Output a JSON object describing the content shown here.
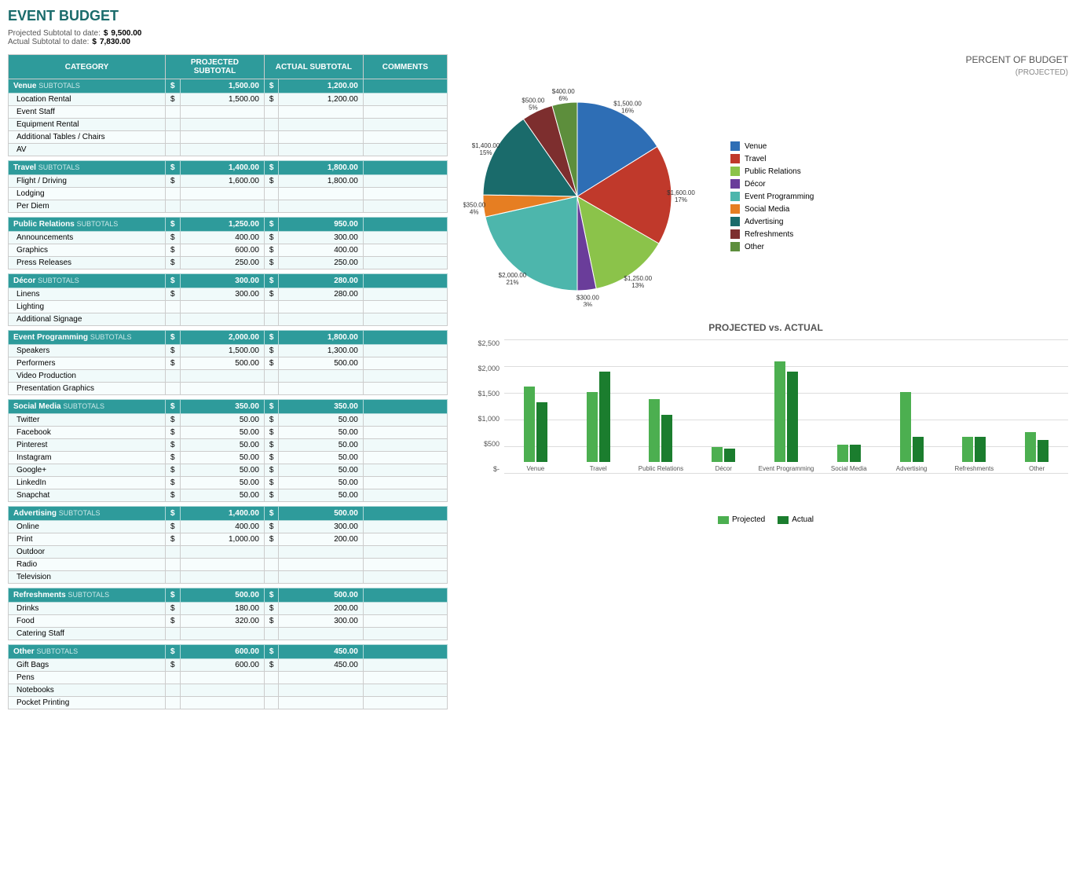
{
  "title": "EVENT BUDGET",
  "summary": {
    "projected_label": "Projected Subtotal to date:",
    "projected_dollar": "$",
    "projected_value": "9,500.00",
    "actual_label": "Actual Subtotal to date:",
    "actual_dollar": "$",
    "actual_value": "7,830.00"
  },
  "table": {
    "headers": {
      "category": "CATEGORY",
      "projected": "PROJECTED SUBTOTAL",
      "actual": "ACTUAL SUBTOTAL",
      "comments": "COMMENTS"
    },
    "sections": [
      {
        "name": "Venue",
        "subtotal_projected": "1,500.00",
        "subtotal_actual": "1,200.00",
        "items": [
          {
            "name": "Location Rental",
            "projected": "1,500.00",
            "actual": "1,200.00"
          },
          {
            "name": "Event Staff",
            "projected": "",
            "actual": ""
          },
          {
            "name": "Equipment Rental",
            "projected": "",
            "actual": ""
          },
          {
            "name": "Additional Tables / Chairs",
            "projected": "",
            "actual": ""
          },
          {
            "name": "AV",
            "projected": "",
            "actual": ""
          }
        ]
      },
      {
        "name": "Travel",
        "subtotal_projected": "1,400.00",
        "subtotal_actual": "1,800.00",
        "items": [
          {
            "name": "Flight / Driving",
            "projected": "1,600.00",
            "actual": "1,800.00"
          },
          {
            "name": "Lodging",
            "projected": "",
            "actual": ""
          },
          {
            "name": "Per Diem",
            "projected": "",
            "actual": ""
          }
        ]
      },
      {
        "name": "Public Relations",
        "subtotal_projected": "1,250.00",
        "subtotal_actual": "950.00",
        "items": [
          {
            "name": "Announcements",
            "projected": "400.00",
            "actual": "300.00"
          },
          {
            "name": "Graphics",
            "projected": "600.00",
            "actual": "400.00"
          },
          {
            "name": "Press Releases",
            "projected": "250.00",
            "actual": "250.00"
          }
        ]
      },
      {
        "name": "Décor",
        "subtotal_projected": "300.00",
        "subtotal_actual": "280.00",
        "items": [
          {
            "name": "Linens",
            "projected": "300.00",
            "actual": "280.00"
          },
          {
            "name": "Lighting",
            "projected": "",
            "actual": ""
          },
          {
            "name": "Additional Signage",
            "projected": "",
            "actual": ""
          }
        ]
      },
      {
        "name": "Event Programming",
        "subtotal_projected": "2,000.00",
        "subtotal_actual": "1,800.00",
        "items": [
          {
            "name": "Speakers",
            "projected": "1,500.00",
            "actual": "1,300.00"
          },
          {
            "name": "Performers",
            "projected": "500.00",
            "actual": "500.00"
          },
          {
            "name": "Video Production",
            "projected": "",
            "actual": ""
          },
          {
            "name": "Presentation Graphics",
            "projected": "",
            "actual": ""
          }
        ]
      },
      {
        "name": "Social Media",
        "subtotal_projected": "350.00",
        "subtotal_actual": "350.00",
        "items": [
          {
            "name": "Twitter",
            "projected": "50.00",
            "actual": "50.00"
          },
          {
            "name": "Facebook",
            "projected": "50.00",
            "actual": "50.00"
          },
          {
            "name": "Pinterest",
            "projected": "50.00",
            "actual": "50.00"
          },
          {
            "name": "Instagram",
            "projected": "50.00",
            "actual": "50.00"
          },
          {
            "name": "Google+",
            "projected": "50.00",
            "actual": "50.00"
          },
          {
            "name": "LinkedIn",
            "projected": "50.00",
            "actual": "50.00"
          },
          {
            "name": "Snapchat",
            "projected": "50.00",
            "actual": "50.00"
          }
        ]
      },
      {
        "name": "Advertising",
        "subtotal_projected": "1,400.00",
        "subtotal_actual": "500.00",
        "items": [
          {
            "name": "Online",
            "projected": "400.00",
            "actual": "300.00"
          },
          {
            "name": "Print",
            "projected": "1,000.00",
            "actual": "200.00"
          },
          {
            "name": "Outdoor",
            "projected": "",
            "actual": ""
          },
          {
            "name": "Radio",
            "projected": "",
            "actual": ""
          },
          {
            "name": "Television",
            "projected": "",
            "actual": ""
          }
        ]
      },
      {
        "name": "Refreshments",
        "subtotal_projected": "500.00",
        "subtotal_actual": "500.00",
        "items": [
          {
            "name": "Drinks",
            "projected": "180.00",
            "actual": "200.00"
          },
          {
            "name": "Food",
            "projected": "320.00",
            "actual": "300.00"
          },
          {
            "name": "Catering Staff",
            "projected": "",
            "actual": ""
          }
        ]
      },
      {
        "name": "Other",
        "subtotal_projected": "600.00",
        "subtotal_actual": "450.00",
        "items": [
          {
            "name": "Gift Bags",
            "projected": "600.00",
            "actual": "450.00"
          },
          {
            "name": "Pens",
            "projected": "",
            "actual": ""
          },
          {
            "name": "Notebooks",
            "projected": "",
            "actual": ""
          },
          {
            "name": "Pocket Printing",
            "projected": "",
            "actual": ""
          }
        ]
      }
    ]
  },
  "pie_chart": {
    "title": "PERCENT OF BUDGET",
    "subtitle": "(PROJECTED)",
    "segments": [
      {
        "name": "Venue",
        "value": 1500,
        "percent": 16,
        "label": "$1,500.00\n16%",
        "color": "#2e6eb5"
      },
      {
        "name": "Travel",
        "value": 1600,
        "percent": 17,
        "label": "$1,600.00\n17%",
        "color": "#c0392b"
      },
      {
        "name": "Public Relations",
        "value": 1250,
        "percent": 13,
        "label": "$1,250.00\n13%",
        "color": "#8bc34a"
      },
      {
        "name": "Décor",
        "value": 300,
        "percent": 3,
        "label": "$300.00\n3%",
        "color": "#6a3d9a"
      },
      {
        "name": "Event Programming",
        "value": 2000,
        "percent": 21,
        "label": "$2,000.00\n21%",
        "color": "#4db6ac"
      },
      {
        "name": "Social Media",
        "value": 350,
        "percent": 4,
        "label": "$350.00\n4%",
        "color": "#e67e22"
      },
      {
        "name": "Advertising",
        "value": 1400,
        "percent": 15,
        "label": "$1,400.00\n15%",
        "color": "#1a6b6b"
      },
      {
        "name": "Refreshments",
        "value": 500,
        "percent": 5,
        "label": "$500.00\n5%",
        "color": "#7d2e2e"
      },
      {
        "name": "Other",
        "value": 400,
        "percent": 6,
        "label": "$400.00\n6%",
        "color": "#5d8e3c"
      }
    ],
    "legend": [
      {
        "label": "Venue",
        "color": "#2e6eb5"
      },
      {
        "label": "Travel",
        "color": "#c0392b"
      },
      {
        "label": "Public Relations",
        "color": "#8bc34a"
      },
      {
        "label": "Décor",
        "color": "#6a3d9a"
      },
      {
        "label": "Event Programming",
        "color": "#4db6ac"
      },
      {
        "label": "Social Media",
        "color": "#e67e22"
      },
      {
        "label": "Advertising",
        "color": "#1a6b6b"
      },
      {
        "label": "Refreshments",
        "color": "#7d2e2e"
      },
      {
        "label": "Other",
        "color": "#5d8e3c"
      }
    ]
  },
  "bar_chart": {
    "title": "PROJECTED vs. ACTUAL",
    "y_labels": [
      "$2,500",
      "$2,000",
      "$1,500",
      "$1,000",
      "$500",
      "$-"
    ],
    "max_value": 2500,
    "groups": [
      {
        "label": "Venue",
        "projected": 1500,
        "actual": 1200
      },
      {
        "label": "Travel",
        "projected": 1400,
        "actual": 1800
      },
      {
        "label": "Public Relations",
        "projected": 1250,
        "actual": 950
      },
      {
        "label": "Décor",
        "projected": 300,
        "actual": 280
      },
      {
        "label": "Event\nProgramming",
        "projected": 2000,
        "actual": 1800
      },
      {
        "label": "Social Media",
        "projected": 350,
        "actual": 350
      },
      {
        "label": "Advertising",
        "projected": 1400,
        "actual": 500
      },
      {
        "label": "Refreshments",
        "projected": 500,
        "actual": 500
      },
      {
        "label": "Other",
        "projected": 600,
        "actual": 450
      }
    ],
    "legend": {
      "projected_label": "Projected",
      "actual_label": "Actual",
      "projected_color": "#4caf50",
      "actual_color": "#1b7d2e"
    }
  }
}
